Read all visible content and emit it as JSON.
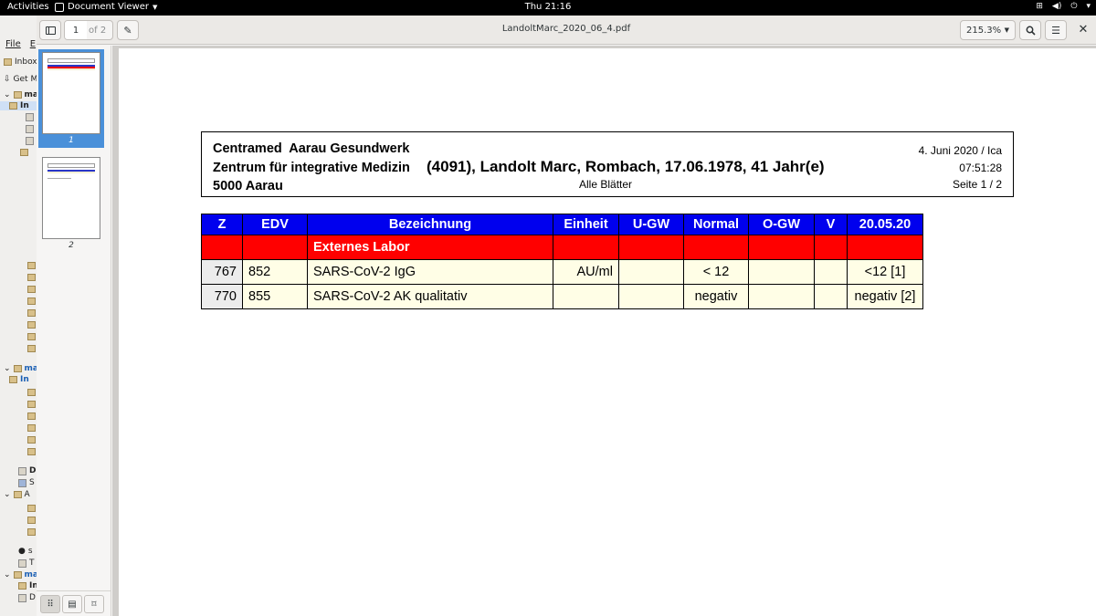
{
  "topbar": {
    "activities": "Activities",
    "app_name": "Document Viewer",
    "clock": "Thu 21:16"
  },
  "background_app": {
    "menu": [
      "File",
      "E"
    ],
    "items": [
      "Inbox",
      "Get M",
      "mai",
      "In",
      "mai",
      "In",
      "D",
      "S",
      "A",
      "s",
      "T",
      "mai",
      "In",
      "D"
    ]
  },
  "viewer": {
    "page_current": "1",
    "page_of": "of 2",
    "document_title": "LandoltMarc_2020_06_4.pdf",
    "zoom": "215.3%",
    "thumbnails": [
      {
        "label": "1",
        "selected": true
      },
      {
        "label": "2",
        "selected": false
      }
    ]
  },
  "report": {
    "org_line1": "Centramed  Aarau Gesundwerk",
    "org_line2": "Zentrum für integrative Medizin",
    "org_line3": "5000 Aarau",
    "patient": "(4091), Landolt Marc, Rombach, 17.06.1978, 41 Jahr(e)",
    "sheets": "Alle Blätter",
    "date": "4. Juni 2020 / Ica",
    "time": "07:51:28",
    "page": "Seite 1 / 2",
    "columns": [
      "Z",
      "EDV",
      "Bezeichnung",
      "Einheit",
      "U-GW",
      "Normal",
      "O-GW",
      "V",
      "20.05.20"
    ],
    "section": "Externes Labor",
    "rows": [
      {
        "z": "767",
        "edv": "852",
        "bezeichnung": "SARS-CoV-2 IgG",
        "einheit": "AU/ml",
        "ugw": "",
        "normal": "< 12",
        "ogw": "",
        "v": "",
        "value": "<12 [1]"
      },
      {
        "z": "770",
        "edv": "855",
        "bezeichnung": "SARS-CoV-2 AK qualitativ",
        "einheit": "",
        "ugw": "",
        "normal": "negativ",
        "ogw": "",
        "v": "",
        "value": "negativ [2]"
      }
    ]
  }
}
